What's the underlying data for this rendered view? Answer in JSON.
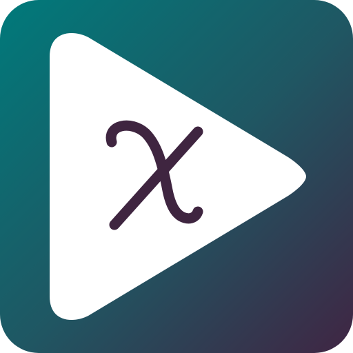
{
  "app_icon": {
    "icon_name": "play-chi-app-icon",
    "background_gradient": {
      "start_color": "#007a7b",
      "mid_color": "#1f5763",
      "end_color": "#402543"
    },
    "play_triangle_color": "#ffffff",
    "glyph_color": "#3f2540"
  }
}
